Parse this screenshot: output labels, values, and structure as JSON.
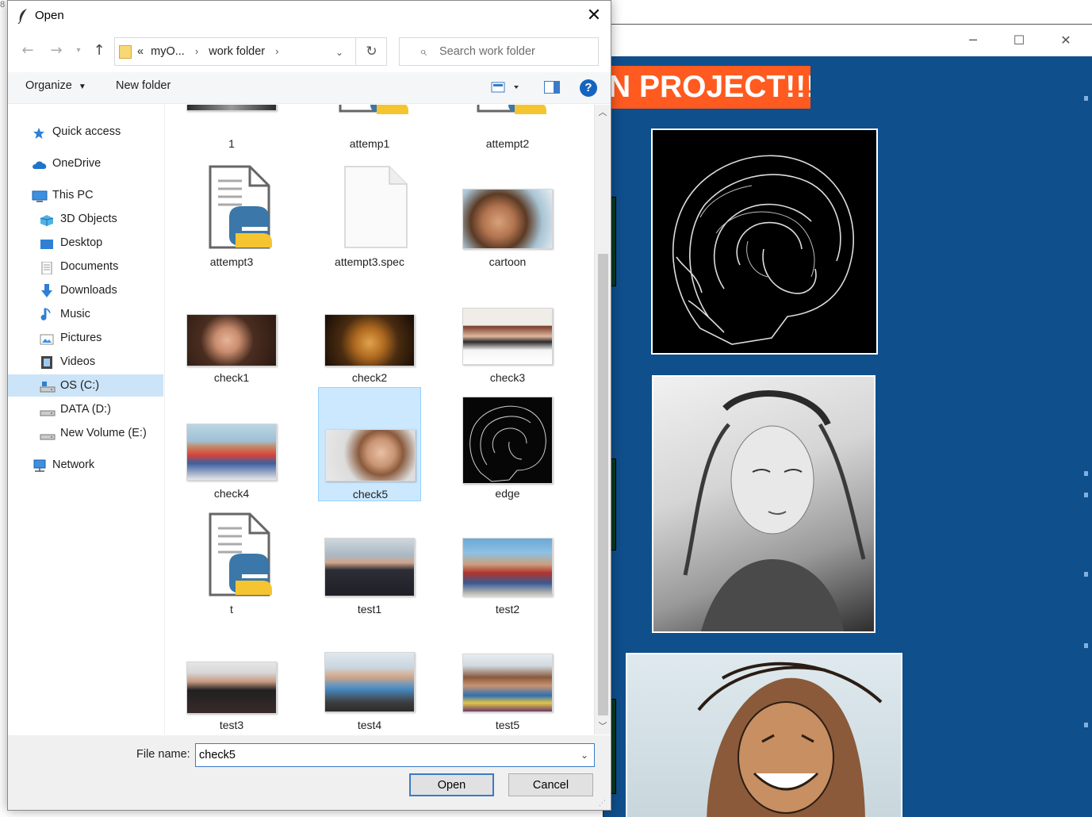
{
  "background_app": {
    "banner_text": "N PROJECT!!!",
    "colors": {
      "background": "#0f4f8c",
      "banner": "#ff5a1f"
    }
  },
  "dialog": {
    "title": "Open",
    "icons": {
      "title": "feather-icon",
      "close": "close-icon"
    }
  },
  "navigation": {
    "back_icon": "arrow-left-icon",
    "forward_icon": "arrow-right-icon",
    "recent_icon": "chevron-down-icon",
    "up_icon": "arrow-up-icon",
    "address": {
      "overflow": "«",
      "crumbs": [
        "myO...",
        "work folder"
      ],
      "refresh_icon": "refresh-icon"
    },
    "search": {
      "placeholder": "Search work folder",
      "icon": "search-icon"
    }
  },
  "toolbar": {
    "organize": "Organize",
    "new_folder": "New folder",
    "view_icon": "view-options-icon",
    "preview_icon": "preview-pane-icon",
    "help_label": "?"
  },
  "sidebar": {
    "items": [
      {
        "label": "Quick access",
        "icon": "star-icon"
      },
      {
        "label": "OneDrive",
        "icon": "cloud-icon"
      },
      {
        "label": "This PC",
        "icon": "computer-icon"
      },
      {
        "label": "3D Objects",
        "icon": "cube-icon"
      },
      {
        "label": "Desktop",
        "icon": "desktop-icon"
      },
      {
        "label": "Documents",
        "icon": "document-icon"
      },
      {
        "label": "Downloads",
        "icon": "download-icon"
      },
      {
        "label": "Music",
        "icon": "music-icon"
      },
      {
        "label": "Pictures",
        "icon": "pictures-icon"
      },
      {
        "label": "Videos",
        "icon": "video-icon"
      },
      {
        "label": "OS (C:)",
        "icon": "drive-icon",
        "selected": true
      },
      {
        "label": "DATA (D:)",
        "icon": "drive-icon"
      },
      {
        "label": "New Volume (E:)",
        "icon": "drive-icon"
      },
      {
        "label": "Network",
        "icon": "network-icon"
      }
    ]
  },
  "files": [
    {
      "name": "1",
      "kind": "photo-bw"
    },
    {
      "name": "attemp1",
      "kind": "python-window"
    },
    {
      "name": "attempt2",
      "kind": "python-window"
    },
    {
      "name": "attempt3",
      "kind": "python"
    },
    {
      "name": "attempt3.spec",
      "kind": "blank"
    },
    {
      "name": "cartoon",
      "kind": "photo"
    },
    {
      "name": "check1",
      "kind": "photo"
    },
    {
      "name": "check2",
      "kind": "photo"
    },
    {
      "name": "check3",
      "kind": "photo"
    },
    {
      "name": "check4",
      "kind": "photo"
    },
    {
      "name": "check5",
      "kind": "photo",
      "selected": true
    },
    {
      "name": "edge",
      "kind": "photo-edge"
    },
    {
      "name": "t",
      "kind": "python"
    },
    {
      "name": "test1",
      "kind": "photo"
    },
    {
      "name": "test2",
      "kind": "photo"
    },
    {
      "name": "test3",
      "kind": "photo"
    },
    {
      "name": "test4",
      "kind": "photo"
    },
    {
      "name": "test5",
      "kind": "photo"
    }
  ],
  "footer": {
    "file_name_label": "File name:",
    "file_name_value": "check5",
    "open_label": "Open",
    "cancel_label": "Cancel"
  }
}
